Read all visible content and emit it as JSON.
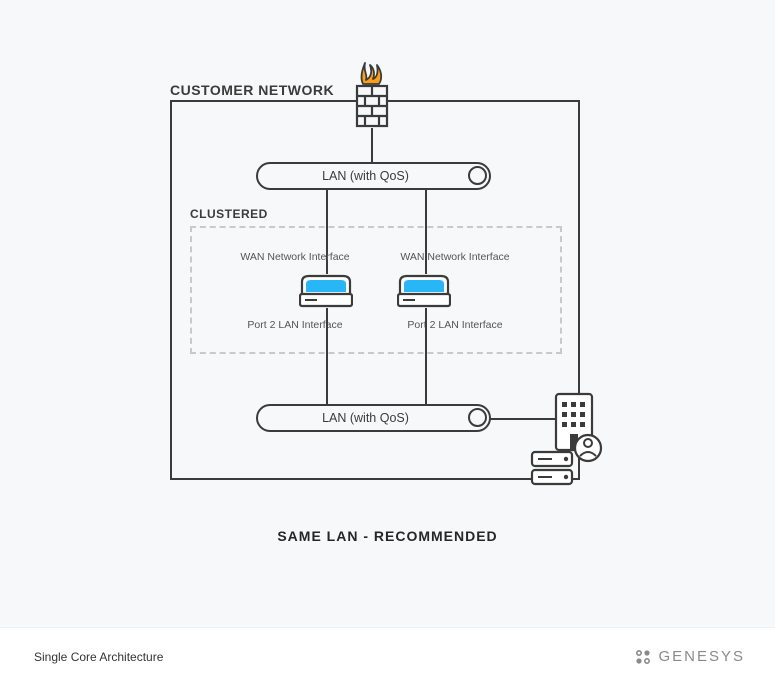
{
  "network": {
    "label": "CUSTOMER NETWORK",
    "firewall_icon": "firewall",
    "lan_top_label": "LAN (with QoS)",
    "cluster_label": "CLUSTERED",
    "nodes": [
      {
        "wan_label": "WAN Network Interface",
        "port_label": "Port 2 LAN Interface"
      },
      {
        "wan_label": "WAN Network Interface",
        "port_label": "Port 2 LAN Interface"
      }
    ],
    "lan_bottom_label": "LAN (with QoS)"
  },
  "caption": "SAME LAN - RECOMMENDED",
  "footer": {
    "title": "Single Core Architecture",
    "brand": "GENESYS"
  },
  "colors": {
    "stroke": "#3b3b3b",
    "dash": "#c9c9c9",
    "accent_blue": "#29b6f6",
    "flame_orange": "#ff9e1b",
    "bg": "#f7f8f9"
  }
}
